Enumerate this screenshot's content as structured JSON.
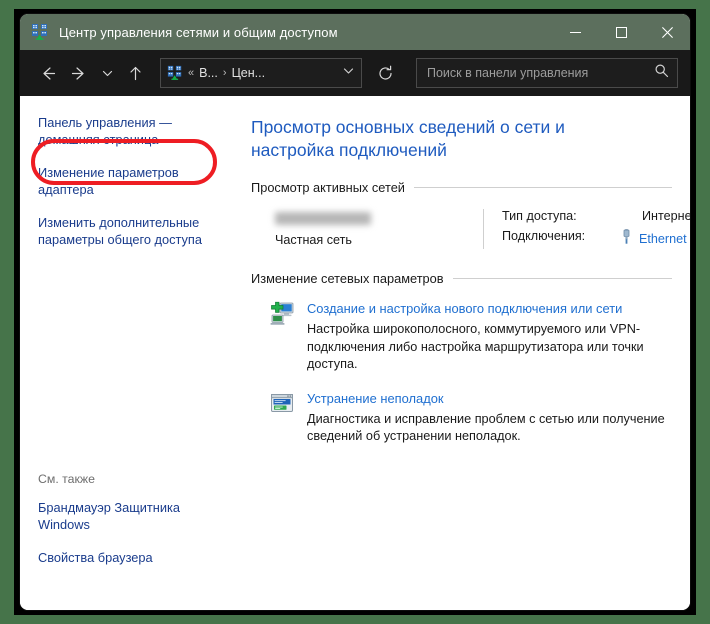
{
  "window": {
    "title": "Центр управления сетями и общим доступом",
    "icon": "network-sharing-center-icon",
    "minimize_label": "Свернуть",
    "maximize_label": "Развернуть",
    "close_label": "Закрыть"
  },
  "toolbar": {
    "back_label": "Назад",
    "forward_label": "Вперёд",
    "recent_label": "Последние расположения",
    "up_label": "Вверх",
    "refresh_label": "Обновить",
    "breadcrumb": {
      "icon": "network-sharing-center-icon",
      "overflow": "«",
      "segments": [
        "В...",
        "Цен..."
      ],
      "separator": "›"
    },
    "search": {
      "placeholder": "Поиск в панели управления",
      "value": "",
      "icon": "search-icon"
    }
  },
  "sidebar": {
    "links": [
      {
        "label": "Панель управления — домашняя страница"
      },
      {
        "label": "Изменение параметров адаптера",
        "highlighted": true
      },
      {
        "label": "Изменить дополнительные параметры общего доступа"
      }
    ],
    "see_also": {
      "title": "См. также",
      "links": [
        {
          "label": "Брандмауэр Защитника Windows"
        },
        {
          "label": "Свойства браузера"
        }
      ]
    }
  },
  "main": {
    "page_title": "Просмотр основных сведений о сети и настройка подключений",
    "active_networks": {
      "heading": "Просмотр активных сетей",
      "network": {
        "name": "",
        "name_redacted": true,
        "type": "Частная сеть"
      },
      "details": [
        {
          "key": "Тип доступа:",
          "value": "Интернет",
          "link": false
        },
        {
          "key": "Подключения:",
          "value": "Ethernet",
          "link": true,
          "icon": "ethernet-adapter-icon"
        }
      ]
    },
    "network_settings": {
      "heading": "Изменение сетевых параметров",
      "tasks": [
        {
          "icon": "new-connection-icon",
          "link": "Создание и настройка нового подключения или сети",
          "description": "Настройка широкополосного, коммутируемого или VPN-подключения либо настройка маршрутизатора или точки доступа."
        },
        {
          "icon": "troubleshoot-icon",
          "link": "Устранение неполадок",
          "description": "Диагностика и исправление проблем с сетью или получение сведений об устранении неполадок."
        }
      ]
    }
  },
  "annotation": {
    "shape": "rounded-rect",
    "color": "#ee1d23",
    "target": "sidebar-link-adapter-settings"
  },
  "colors": {
    "desktop": "#46744a",
    "titlebar": "#5c6f5d",
    "toolbar": "#191919",
    "content": "#ffffff",
    "link": "#1f6fd0",
    "heading": "#1f5bbf",
    "annotation": "#ee1d23"
  }
}
